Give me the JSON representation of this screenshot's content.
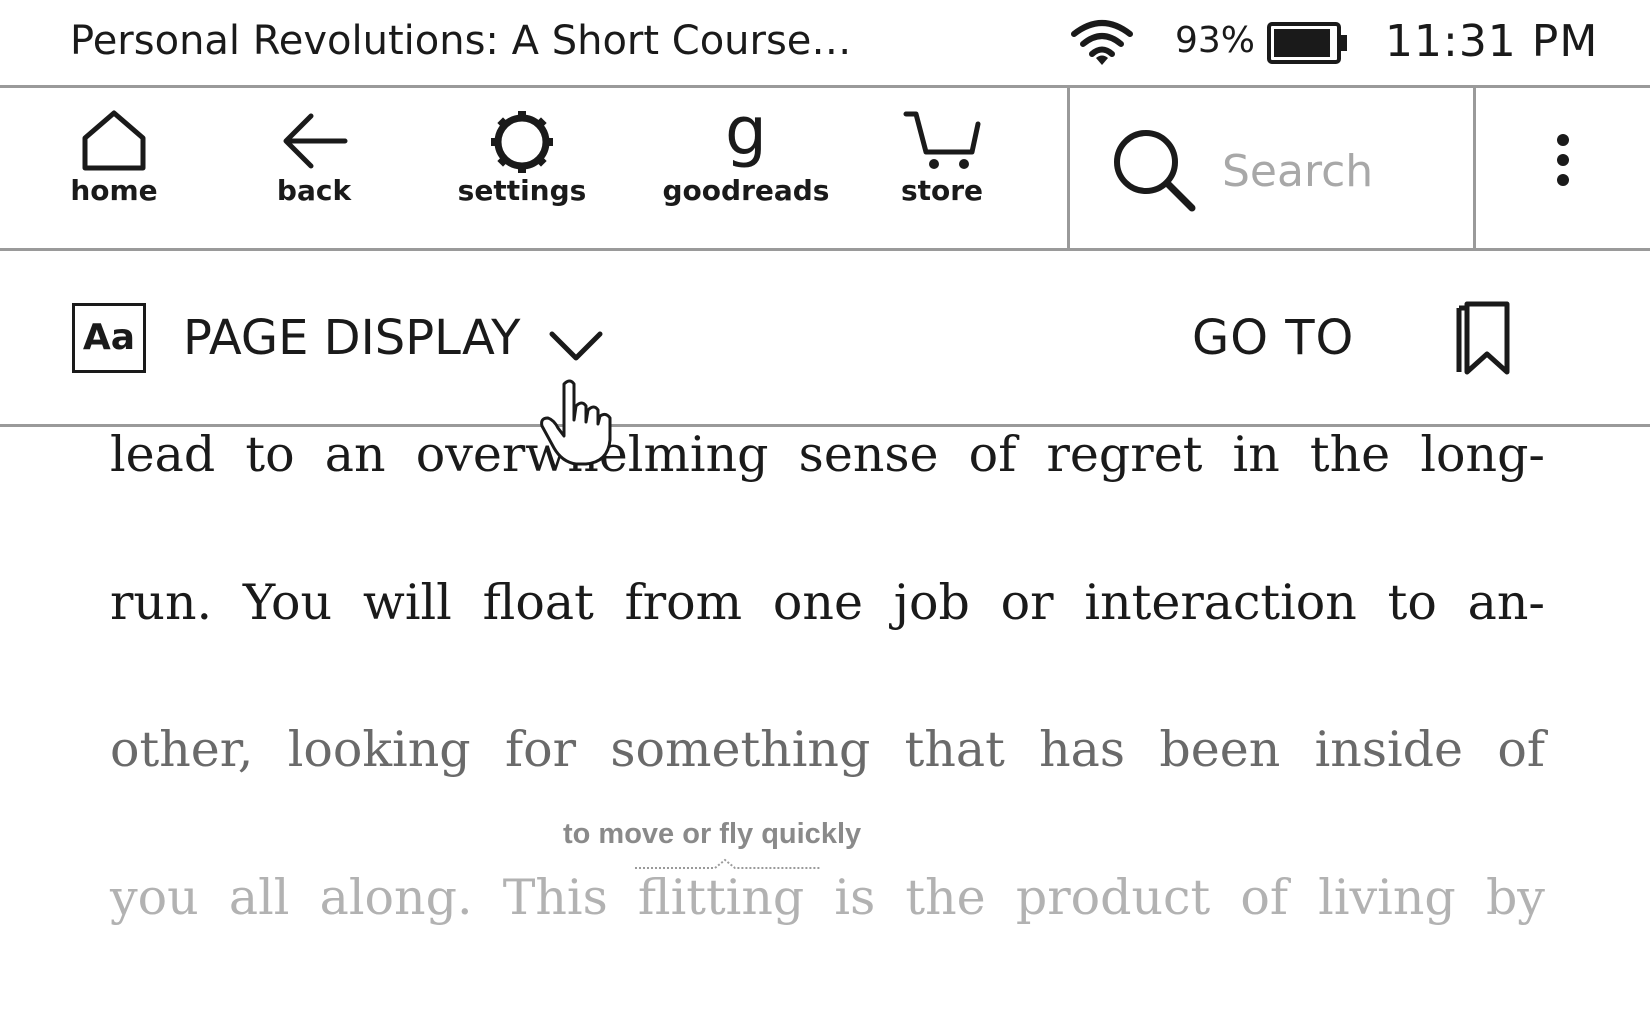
{
  "status_bar": {
    "book_title": "Personal Revolutions: A Short Course…",
    "battery_percent": "93%",
    "battery_level": 0.93,
    "time": "11:31 PM"
  },
  "toolbar": {
    "items": [
      {
        "label": "home",
        "icon": "home-icon"
      },
      {
        "label": "back",
        "icon": "back-arrow-icon"
      },
      {
        "label": "settings",
        "icon": "gear-icon"
      },
      {
        "label": "goodreads",
        "icon": "goodreads-icon"
      },
      {
        "label": "store",
        "icon": "cart-icon"
      }
    ],
    "search": {
      "placeholder": "Search",
      "icon": "search-icon"
    },
    "more_icon": "more-vertical-icon"
  },
  "reader_bar": {
    "font_button": "Aa",
    "page_display_label": "PAGE DISPLAY",
    "goto_label": "GO TO",
    "bookmark_icon": "bookmark-icon"
  },
  "reading": {
    "lines": [
      "lead to an overwhelming sense of regret in the long-",
      "run. You will float from one job or interaction to an-",
      "other, looking for something that has been inside of",
      "you all along. This flitting is the product of living by"
    ],
    "definition_tooltip": "to move or fly quickly"
  },
  "colors": {
    "text": "#1a1a1a",
    "divider": "#9a9a9a",
    "faded_text": "#6a6a6a",
    "faint_text": "#b2b2b2"
  }
}
